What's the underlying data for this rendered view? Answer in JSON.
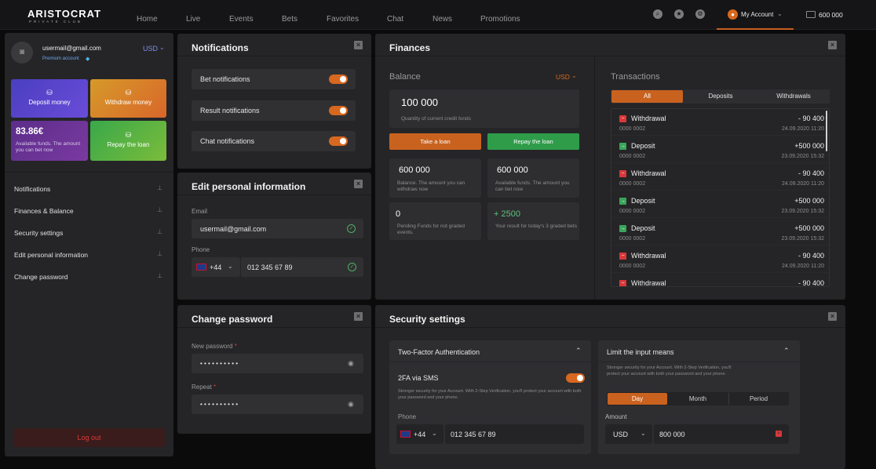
{
  "brand": {
    "name": "ARISTOCRAT",
    "tagline": "PRIVATE CLUB"
  },
  "nav": [
    "Home",
    "Live",
    "Events",
    "Bets",
    "Favorites",
    "Chat",
    "News",
    "Promotions"
  ],
  "header": {
    "account_label": "My Account",
    "balance": "600 000",
    "icons": [
      "search-icon",
      "star-icon",
      "gear-icon"
    ]
  },
  "profile": {
    "email": "usermail@gmail.com",
    "status": "Premium account",
    "currency": "USD"
  },
  "cards": {
    "deposit": "Deposit money",
    "withdraw": "Withdraw money",
    "funds_value": "83.86€",
    "funds_note": "Available funds. The amount you can bet now",
    "repay": "Repay the loan"
  },
  "menu": [
    "Notifications",
    "Finances & Balance",
    "Security settings",
    "Edit personal information",
    "Change password"
  ],
  "logout": "Log out",
  "notifications": {
    "title": "Notifications",
    "items": [
      "Bet notifications",
      "Result notifications",
      "Chat notifications"
    ]
  },
  "personal": {
    "title": "Edit personal information",
    "email_label": "Email",
    "email": "usermail@gmail.com",
    "phone_label": "Phone",
    "code": "+44",
    "phone": "012 345 67 89"
  },
  "password": {
    "title": "Change password",
    "new_label": "New password",
    "repeat_label": "Repeat",
    "masked": "• • • • • • • • • •",
    "required": "*"
  },
  "finances": {
    "title": "Finances",
    "balance_label": "Balance",
    "currency": "USD",
    "credit_value": "100 000",
    "credit_note": "Quantity of current credit funds",
    "take_loan": "Take a loan",
    "repay_loan": "Repay the loan",
    "stats": [
      {
        "value": "600 000",
        "note": "Balance. The amount you can withdraw now"
      },
      {
        "value": "600 000",
        "note": "Available funds. The amount you can bet now"
      },
      {
        "value": "0",
        "note": "Pending Funds for not graded events."
      },
      {
        "value": "+ 2500",
        "note": "Your result for today's 3 graded bets"
      }
    ],
    "transactions_label": "Transactions",
    "tabs": [
      "All",
      "Deposits",
      "Withdrawals"
    ],
    "transactions": [
      {
        "type": "Withdrawal",
        "amount": "- 90 400",
        "id": "0000 0002",
        "datetime": "24.09.2020  11:20",
        "kind": "out"
      },
      {
        "type": "Deposit",
        "amount": "+500 000",
        "id": "0000 0002",
        "datetime": "23.09.2020  15:32",
        "kind": "in"
      },
      {
        "type": "Withdrawal",
        "amount": "- 90 400",
        "id": "0000 0002",
        "datetime": "24.09.2020  11:20",
        "kind": "out"
      },
      {
        "type": "Deposit",
        "amount": "+500 000",
        "id": "0000 0002",
        "datetime": "23.09.2020  15:32",
        "kind": "in"
      },
      {
        "type": "Deposit",
        "amount": "+500 000",
        "id": "0000 0002",
        "datetime": "23.09.2020  15:32",
        "kind": "in"
      },
      {
        "type": "Withdrawal",
        "amount": "- 90 400",
        "id": "0000 0002",
        "datetime": "24.09.2020  11:20",
        "kind": "out"
      },
      {
        "type": "Withdrawal",
        "amount": "- 90 400",
        "id": "",
        "datetime": "",
        "kind": "out"
      }
    ],
    "colors": {
      "out": "#d9383a",
      "in": "#3aa55a"
    }
  },
  "security": {
    "title": "Security settings",
    "tfa_title": "Two-Factor Authentication",
    "sms_label": "2FA via SMS",
    "sms_desc": "Stronger security for your Account. With 2-Step Verification, you'll protect your account with both your password and your phone.",
    "phone_label": "Phone",
    "code": "+44",
    "phone": "012 345 67 89",
    "limit_title": "Limit the input means",
    "limit_desc": "Stronger security for your Account. With 2-Step Verification, you'll protect your account with both your password and your phone.",
    "periods": [
      "Day",
      "Month",
      "Period"
    ],
    "amount_label": "Amount",
    "amount_currency": "USD",
    "amount": "800 000"
  },
  "colors": {
    "accent": "#d8681f",
    "panel": "#252527",
    "green": "#3aa55a"
  }
}
